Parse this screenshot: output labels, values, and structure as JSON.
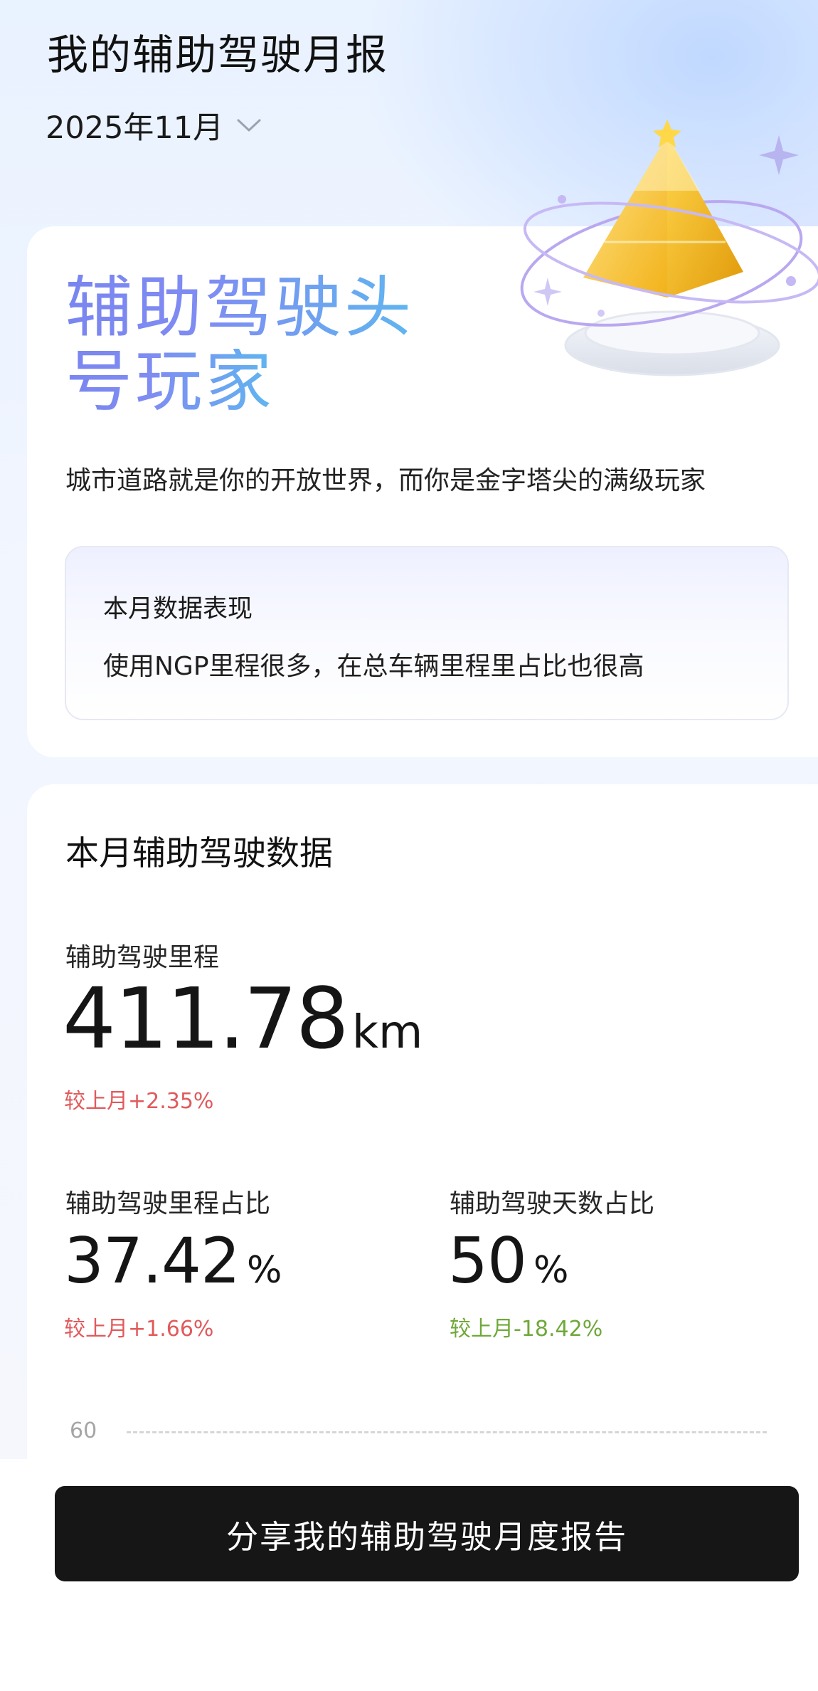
{
  "header": {
    "title": "我的辅助驾驶月报",
    "month": "2025年11月"
  },
  "hero": {
    "title_line1": "辅助驾驶头",
    "title_line2": "号玩家",
    "description": "城市道路就是你的开放世界，而你是金字塔尖的满级玩家",
    "performance": {
      "title": "本月数据表现",
      "text": "使用NGP里程很多，在总车辆里程里占比也很高"
    },
    "badge_icon": "pyramid-trophy-icon"
  },
  "stats": {
    "section_title": "本月辅助驾驶数据",
    "mileage": {
      "label": "辅助驾驶里程",
      "value": "411.78",
      "unit": "km",
      "delta": "较上月+2.35%"
    },
    "mileage_ratio": {
      "label": "辅助驾驶里程占比",
      "value": "37.42",
      "unit": "%",
      "delta": "较上月+1.66%"
    },
    "days_ratio": {
      "label": "辅助驾驶天数占比",
      "value": "50",
      "unit": "%",
      "delta": "较上月-18.42%"
    },
    "chart_tick": "60"
  },
  "footer": {
    "share_label": "分享我的辅助驾驶月度报告"
  },
  "colors": {
    "positive_delta": "#e05a5c",
    "negative_delta": "#6fa83a",
    "button_bg": "#161616"
  }
}
